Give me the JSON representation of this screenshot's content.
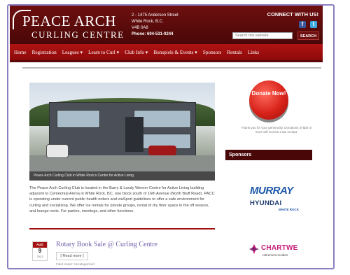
{
  "header": {
    "logo_title": "PEACE ARCH",
    "logo_subtitle": "CURLING CENTRE",
    "address_line1": "2 - 1475 Anderson Street",
    "address_line2": "White Rock, B.C.",
    "address_line3": "V4B 0A8",
    "phone": "Phone: 604-531-0244",
    "connect_label": "CONNECT WITH US!",
    "social": [
      "facebook-icon",
      "twitter-icon"
    ],
    "search_placeholder": "Search this website",
    "search_button": "SEARCH"
  },
  "nav": {
    "items": [
      {
        "label": "Home"
      },
      {
        "label": "Registration"
      },
      {
        "label": "Leagues ▾"
      },
      {
        "label": "Learn to Curl ▾"
      },
      {
        "label": "Club Info ▾"
      },
      {
        "label": "Bonspiels & Events ▾"
      },
      {
        "label": "Sponsors"
      },
      {
        "label": "Rentals"
      },
      {
        "label": "Links"
      }
    ]
  },
  "main": {
    "photo_caption": "Peace Arch Curling Club in White Rock's Centre for Active Living",
    "intro_text": "The Peace Arch Curling Club is located in the Barry & Landy Werner Centre for Active Living building adjacent to Centennial Arena in White Rock, BC, one block south of 16th Avenue (North Bluff Road). PACC is operating under current public health orders and viaSport guidelines to offer a safe environment for curling and socializing. We offer ice rentals for private groups, rental of dry floor space in the off season, and lounge rents. For parties, meetings, and other functions.",
    "post": {
      "month": "AUG",
      "day": "9",
      "year": "2021",
      "title": "Rotary Book Sale @ Curling Centre",
      "read_more": "[ Read more ]",
      "filed_under": "Filed Under: Uncategorized"
    }
  },
  "sidebar": {
    "donate_label": "Donate Now!",
    "donate_note": "Thank you for your generosity. Donations of $20 or more will receive a tax receipt.",
    "sponsors_heading": "Sponsors",
    "sponsor1_name": "MURRAY",
    "sponsor1_sub": "HYUNDAI",
    "sponsor1_loc": "WHITE ROCK",
    "sponsor2_name": "CHARTWE",
    "sponsor2_sub": "retirement residen"
  },
  "colors": {
    "header_bg": "#6e0f0f",
    "nav_bg": "#b11313",
    "accent_link": "#6f5da8"
  }
}
